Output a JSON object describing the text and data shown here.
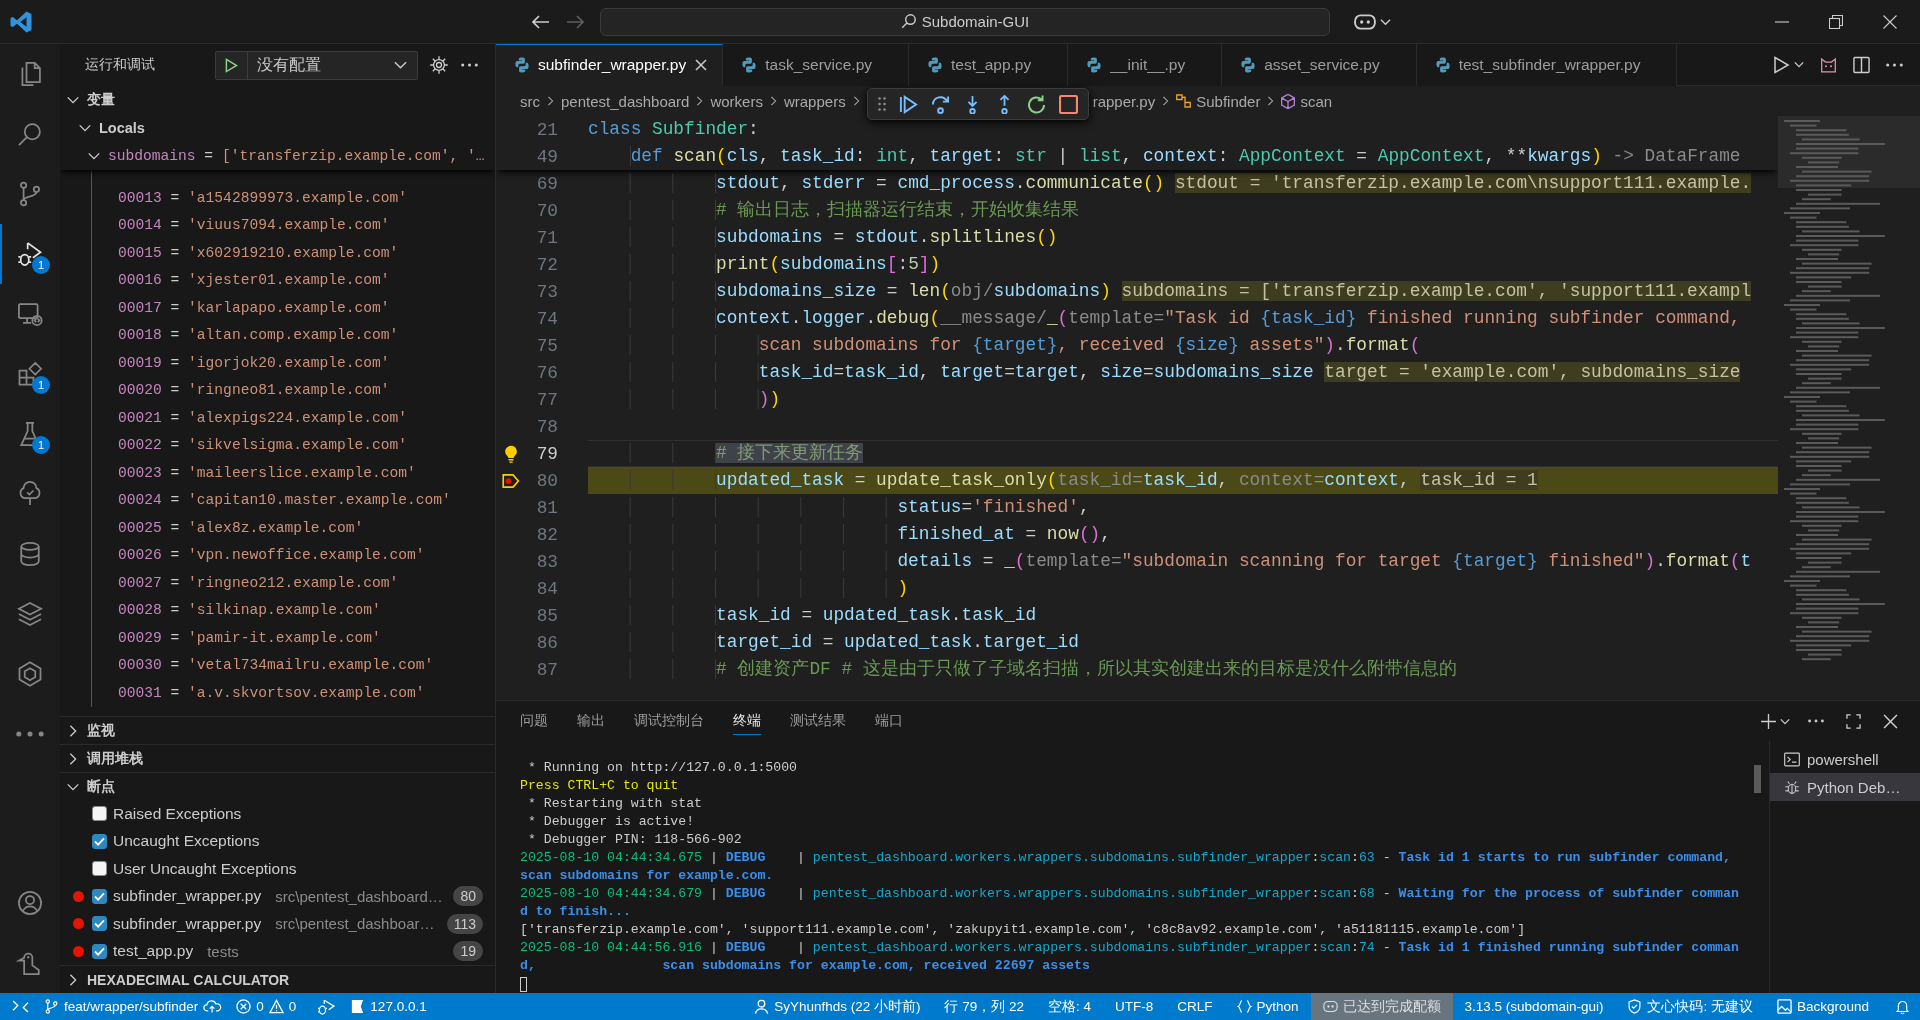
{
  "title_bar": {
    "nav": [
      {
        "disabled": false
      },
      {
        "disabled": true
      }
    ],
    "search": "Subdomain-GUI"
  },
  "activity_bar": {
    "items": [
      {
        "selected": false
      },
      {
        "selected": false
      },
      {
        "selected": false
      },
      {
        "selected": true,
        "badge": "1"
      },
      {
        "selected": false
      },
      {
        "selected": false,
        "badge": "1"
      },
      {
        "selected": false,
        "badge": "1"
      },
      {
        "selected": false
      },
      {
        "selected": false
      },
      {
        "selected": false
      },
      {
        "selected": false
      },
      {
        "selected": false
      }
    ],
    "bottom": [
      {
        "selected": false
      },
      {
        "selected": false
      }
    ]
  },
  "sidebar": {
    "title": "运行和调试",
    "configuration": "没有配置",
    "sections": [
      {
        "kind": "variables",
        "title": "变量",
        "expanded": true,
        "scopes": [
          {
            "name": "Locals",
            "expanded": true,
            "variables": [
              {
                "name": "subdomains",
                "sign": "=",
                "value": "['transferzip.example.com', '…",
                "expanded": true,
                "children": [
                  {
                    "name": "00013",
                    "sign": "=",
                    "value": "'a1542899973.example.com'"
                  },
                  {
                    "name": "00014",
                    "sign": "=",
                    "value": "'viuus7094.example.com'"
                  },
                  {
                    "name": "00015",
                    "sign": "=",
                    "value": "'x602919210.example.com'"
                  },
                  {
                    "name": "00016",
                    "sign": "=",
                    "value": "'xjester01.example.com'"
                  },
                  {
                    "name": "00017",
                    "sign": "=",
                    "value": "'karlapapo.example.com'"
                  },
                  {
                    "name": "00018",
                    "sign": "=",
                    "value": "'altan.comp.example.com'"
                  },
                  {
                    "name": "00019",
                    "sign": "=",
                    "value": "'igorjok20.example.com'"
                  },
                  {
                    "name": "00020",
                    "sign": "=",
                    "value": "'ringneo81.example.com'"
                  },
                  {
                    "name": "00021",
                    "sign": "=",
                    "value": "'alexpigs224.example.com'"
                  },
                  {
                    "name": "00022",
                    "sign": "=",
                    "value": "'sikvelsigma.example.com'"
                  },
                  {
                    "name": "00023",
                    "sign": "=",
                    "value": "'maileerslice.example.com'"
                  },
                  {
                    "name": "00024",
                    "sign": "=",
                    "value": "'capitan10.master.example.com'"
                  },
                  {
                    "name": "00025",
                    "sign": "=",
                    "value": "'alex8z.example.com'"
                  },
                  {
                    "name": "00026",
                    "sign": "=",
                    "value": "'vpn.newoffice.example.com'"
                  },
                  {
                    "name": "00027",
                    "sign": "=",
                    "value": "'ringneo212.example.com'"
                  },
                  {
                    "name": "00028",
                    "sign": "=",
                    "value": "'silkinap.example.com'"
                  },
                  {
                    "name": "00029",
                    "sign": "=",
                    "value": "'pamir-it.example.com'"
                  },
                  {
                    "name": "00030",
                    "sign": "=",
                    "value": "'vetal734mailru.example.com'"
                  },
                  {
                    "name": "00031",
                    "sign": "=",
                    "value": "'a.v.skvortsov.example.com'"
                  }
                ]
              }
            ]
          }
        ]
      },
      {
        "kind": "plain",
        "title": "监视",
        "expanded": false
      },
      {
        "kind": "plain",
        "title": "调用堆栈",
        "expanded": false
      },
      {
        "kind": "breakpoints",
        "title": "断点",
        "expanded": true,
        "items": [
          {
            "kind": "exception",
            "label": "Raised Exceptions",
            "checked": false
          },
          {
            "kind": "exception",
            "label": "Uncaught Exceptions",
            "checked": true
          },
          {
            "kind": "exception",
            "label": "User Uncaught Exceptions",
            "checked": false
          },
          {
            "kind": "file",
            "label": "subfinder_wrapper.py",
            "path": "src\\pentest_dashboard…",
            "line": "80",
            "checked": true
          },
          {
            "kind": "file",
            "label": "subfinder_wrapper.py",
            "path": "src\\pentest_dashboar…",
            "line": "113",
            "checked": true
          },
          {
            "kind": "file",
            "label": "test_app.py",
            "path": "tests",
            "line": "19",
            "checked": true
          }
        ]
      },
      {
        "kind": "plain",
        "title": "HEXADECIMAL CALCULATOR",
        "expanded": false
      }
    ]
  },
  "editor": {
    "tabs": [
      {
        "label": "subfinder_wrapper.py",
        "selected": true
      },
      {
        "label": "task_service.py",
        "selected": false
      },
      {
        "label": "test_app.py",
        "selected": false
      },
      {
        "label": "__init__.py",
        "selected": false
      },
      {
        "label": "asset_service.py",
        "selected": false
      },
      {
        "label": "test_subfinder_wrapper.py",
        "selected": false
      }
    ],
    "breadcrumbs": {
      "before_toolbar": [
        {
          "kind": "path",
          "label": "src"
        },
        {
          "kind": "path",
          "label": "pentest_dashboard"
        },
        {
          "kind": "path",
          "label": "workers"
        },
        {
          "kind": "path",
          "label": "wrappers"
        }
      ],
      "after_toolbar": [
        {
          "kind": "path",
          "label": "rapper.py"
        },
        {
          "kind": "class",
          "label": "Subfinder"
        },
        {
          "kind": "method",
          "label": "scan"
        }
      ]
    },
    "sticky": [
      {
        "number": "21",
        "tokens": [
          {
            "kind": "kw",
            "text": "class "
          },
          {
            "kind": "cls",
            "text": "Subfinder"
          },
          {
            "kind": "op",
            "text": ":"
          }
        ]
      },
      {
        "number": "49",
        "tokens": [
          {
            "kind": "kw",
            "text": "    def "
          },
          {
            "kind": "fn",
            "text": "scan"
          },
          {
            "kind": "br1",
            "text": "("
          },
          {
            "kind": "var",
            "text": "cls"
          },
          {
            "kind": "op",
            "text": ", "
          },
          {
            "kind": "var",
            "text": "task_id"
          },
          {
            "kind": "op",
            "text": ": "
          },
          {
            "kind": "cls",
            "text": "int"
          },
          {
            "kind": "op",
            "text": ", "
          },
          {
            "kind": "var",
            "text": "target"
          },
          {
            "kind": "op",
            "text": ": "
          },
          {
            "kind": "cls",
            "text": "str"
          },
          {
            "kind": "op",
            "text": " | "
          },
          {
            "kind": "cls",
            "text": "list"
          },
          {
            "kind": "op",
            "text": ", "
          },
          {
            "kind": "var",
            "text": "context"
          },
          {
            "kind": "op",
            "text": ": "
          },
          {
            "kind": "cls",
            "text": "AppContext"
          },
          {
            "kind": "op",
            "text": " = "
          },
          {
            "kind": "cls",
            "text": "AppContext"
          },
          {
            "kind": "op",
            "text": ", **"
          },
          {
            "kind": "var",
            "text": "kwargs"
          },
          {
            "kind": "br1",
            "text": ")"
          },
          {
            "kind": "hint",
            "text": " -> DataFrame"
          }
        ]
      }
    ],
    "lines": [
      {
        "number": "69",
        "active": false,
        "paused": false,
        "code_action": false,
        "tokens": [
          {
            "kind": "var",
            "text": "            stdout"
          },
          {
            "kind": "op",
            "text": ", "
          },
          {
            "kind": "var",
            "text": "stderr"
          },
          {
            "kind": "op",
            "text": " = "
          },
          {
            "kind": "var",
            "text": "cmd_process"
          },
          {
            "kind": "op",
            "text": "."
          },
          {
            "kind": "fn",
            "text": "communicate"
          },
          {
            "kind": "br1",
            "text": "() "
          },
          {
            "kind": "inline",
            "text": "stdout = 'transferzip.example.com\\nsupport111.example."
          }
        ]
      },
      {
        "number": "70",
        "active": false,
        "paused": false,
        "code_action": false,
        "tokens": [
          {
            "kind": "com",
            "text": "            # 输出日志，扫描器运行结束，开始收集结果"
          }
        ]
      },
      {
        "number": "71",
        "active": false,
        "paused": false,
        "code_action": false,
        "tokens": [
          {
            "kind": "var",
            "text": "            subdomains"
          },
          {
            "kind": "op",
            "text": " = "
          },
          {
            "kind": "var",
            "text": "stdout"
          },
          {
            "kind": "op",
            "text": "."
          },
          {
            "kind": "fn",
            "text": "splitlines"
          },
          {
            "kind": "br1",
            "text": "()"
          }
        ]
      },
      {
        "number": "72",
        "active": false,
        "paused": false,
        "code_action": false,
        "tokens": [
          {
            "kind": "fn",
            "text": "            print"
          },
          {
            "kind": "br1",
            "text": "("
          },
          {
            "kind": "var",
            "text": "subdomains"
          },
          {
            "kind": "br2",
            "text": "["
          },
          {
            "kind": "op",
            "text": ":"
          },
          {
            "kind": "num",
            "text": "5"
          },
          {
            "kind": "br2",
            "text": "]"
          },
          {
            "kind": "br1",
            "text": ")"
          }
        ]
      },
      {
        "number": "73",
        "active": false,
        "paused": false,
        "code_action": false,
        "tokens": [
          {
            "kind": "var",
            "text": "            subdomains_size"
          },
          {
            "kind": "op",
            "text": " = "
          },
          {
            "kind": "fn",
            "text": "len"
          },
          {
            "kind": "br1",
            "text": "("
          },
          {
            "kind": "hint",
            "text": "obj/"
          },
          {
            "kind": "var",
            "text": "subdomains"
          },
          {
            "kind": "br1",
            "text": ") "
          },
          {
            "kind": "inline",
            "text": "subdomains = ['transferzip.example.com', 'support111.exampl"
          }
        ]
      },
      {
        "number": "74",
        "active": false,
        "paused": false,
        "code_action": false,
        "tokens": [
          {
            "kind": "var",
            "text": "            context"
          },
          {
            "kind": "op",
            "text": "."
          },
          {
            "kind": "var",
            "text": "logger"
          },
          {
            "kind": "op",
            "text": "."
          },
          {
            "kind": "fn",
            "text": "debug"
          },
          {
            "kind": "br1",
            "text": "("
          },
          {
            "kind": "hint",
            "text": "__message/"
          },
          {
            "kind": "fn",
            "text": "_"
          },
          {
            "kind": "br2",
            "text": "("
          },
          {
            "kind": "hint",
            "text": "template="
          },
          {
            "kind": "str",
            "text": "\"Task id "
          },
          {
            "kind": "fmt",
            "text": "{task_id}"
          },
          {
            "kind": "str",
            "text": " finished running subfinder command,"
          }
        ]
      },
      {
        "number": "75",
        "active": false,
        "paused": false,
        "code_action": false,
        "tokens": [
          {
            "kind": "str",
            "text": "                scan subdomains for "
          },
          {
            "kind": "fmt",
            "text": "{target}"
          },
          {
            "kind": "str",
            "text": ", received "
          },
          {
            "kind": "fmt",
            "text": "{size}"
          },
          {
            "kind": "str",
            "text": " assets\""
          },
          {
            "kind": "br2",
            "text": ")"
          },
          {
            "kind": "op",
            "text": "."
          },
          {
            "kind": "fn",
            "text": "format"
          },
          {
            "kind": "br2",
            "text": "("
          }
        ]
      },
      {
        "number": "76",
        "active": false,
        "paused": false,
        "code_action": false,
        "tokens": [
          {
            "kind": "var",
            "text": "                task_id"
          },
          {
            "kind": "op",
            "text": "="
          },
          {
            "kind": "var",
            "text": "task_id"
          },
          {
            "kind": "op",
            "text": ", "
          },
          {
            "kind": "var",
            "text": "target"
          },
          {
            "kind": "op",
            "text": "="
          },
          {
            "kind": "var",
            "text": "target"
          },
          {
            "kind": "op",
            "text": ", "
          },
          {
            "kind": "var",
            "text": "size"
          },
          {
            "kind": "op",
            "text": "="
          },
          {
            "kind": "var",
            "text": "subdomains_size "
          },
          {
            "kind": "inline",
            "text": "target = 'example.com', subdomains_size"
          }
        ]
      },
      {
        "number": "77",
        "active": false,
        "paused": false,
        "code_action": false,
        "tokens": [
          {
            "kind": "br2",
            "text": "                )"
          },
          {
            "kind": "br1",
            "text": ")"
          }
        ]
      },
      {
        "number": "78",
        "active": false,
        "paused": false,
        "code_action": false
      },
      {
        "number": "79",
        "active": true,
        "paused": false,
        "code_action": true,
        "tokens": [
          {
            "kind": "sel",
            "text": "            # 接下来更新任务"
          }
        ]
      },
      {
        "number": "80",
        "active": false,
        "paused": true,
        "code_action": false,
        "tokens": [
          {
            "kind": "var",
            "text": "            updated_task"
          },
          {
            "kind": "op",
            "text": " = "
          },
          {
            "kind": "fn",
            "text": "update_task_only"
          },
          {
            "kind": "br1",
            "text": "("
          },
          {
            "kind": "hint",
            "text": "task_id="
          },
          {
            "kind": "var",
            "text": "task_id"
          },
          {
            "kind": "op",
            "text": ", "
          },
          {
            "kind": "hint",
            "text": "context="
          },
          {
            "kind": "var",
            "text": "context"
          },
          {
            "kind": "op",
            "text": ", "
          },
          {
            "kind": "inline",
            "text": "task_id = 1"
          }
        ]
      },
      {
        "number": "81",
        "active": false,
        "paused": false,
        "code_action": false,
        "tokens": [
          {
            "kind": "var",
            "text": "                             status"
          },
          {
            "kind": "op",
            "text": "="
          },
          {
            "kind": "str",
            "text": "'finished'"
          },
          {
            "kind": "op",
            "text": ","
          }
        ]
      },
      {
        "number": "82",
        "active": false,
        "paused": false,
        "code_action": false,
        "tokens": [
          {
            "kind": "var",
            "text": "                             finished_at"
          },
          {
            "kind": "op",
            "text": " = "
          },
          {
            "kind": "fn",
            "text": "now"
          },
          {
            "kind": "br2",
            "text": "()"
          },
          {
            "kind": "op",
            "text": ","
          }
        ]
      },
      {
        "number": "83",
        "active": false,
        "paused": false,
        "code_action": false,
        "tokens": [
          {
            "kind": "var",
            "text": "                             details"
          },
          {
            "kind": "op",
            "text": " = "
          },
          {
            "kind": "fn",
            "text": "_"
          },
          {
            "kind": "br2",
            "text": "("
          },
          {
            "kind": "hint",
            "text": "template="
          },
          {
            "kind": "str",
            "text": "\"subdomain scanning for target "
          },
          {
            "kind": "fmt",
            "text": "{target}"
          },
          {
            "kind": "str",
            "text": " finished\""
          },
          {
            "kind": "br2",
            "text": ")"
          },
          {
            "kind": "op",
            "text": "."
          },
          {
            "kind": "fn",
            "text": "format"
          },
          {
            "kind": "br2",
            "text": "("
          },
          {
            "kind": "var",
            "text": "t"
          }
        ]
      },
      {
        "number": "84",
        "active": false,
        "paused": false,
        "code_action": false,
        "tokens": [
          {
            "kind": "br1",
            "text": "                             )"
          }
        ]
      },
      {
        "number": "85",
        "active": false,
        "paused": false,
        "code_action": false,
        "tokens": [
          {
            "kind": "var",
            "text": "            task_id"
          },
          {
            "kind": "op",
            "text": " = "
          },
          {
            "kind": "var",
            "text": "updated_task"
          },
          {
            "kind": "op",
            "text": "."
          },
          {
            "kind": "var",
            "text": "task_id"
          }
        ]
      },
      {
        "number": "86",
        "active": false,
        "paused": false,
        "code_action": false,
        "tokens": [
          {
            "kind": "var",
            "text": "            target_id"
          },
          {
            "kind": "op",
            "text": " = "
          },
          {
            "kind": "var",
            "text": "updated_task"
          },
          {
            "kind": "op",
            "text": "."
          },
          {
            "kind": "var",
            "text": "target_id"
          }
        ]
      },
      {
        "number": "87",
        "active": false,
        "paused": false,
        "code_action": false,
        "tokens": [
          {
            "kind": "com",
            "text": "            # 创建资产DF # 这是由于只做了子域名扫描，所以其实创建出来的目标是没什么附带信息的"
          }
        ]
      }
    ]
  },
  "panel": {
    "tabs": [
      {
        "label": "问题",
        "selected": false
      },
      {
        "label": "输出",
        "selected": false
      },
      {
        "label": "调试控制台",
        "selected": false
      },
      {
        "label": "终端",
        "selected": true
      },
      {
        "label": "测试结果",
        "selected": false
      },
      {
        "label": "端口",
        "selected": false
      }
    ],
    "terminal": {
      "cursor": true,
      "lines": [
        {
          "segments": [
            {
              "kind": "plain",
              "text": " * Running on http://127.0.0.1:5000"
            }
          ]
        },
        {
          "segments": [
            {
              "kind": "yellow",
              "text": "Press CTRL+C to quit"
            }
          ]
        },
        {
          "segments": [
            {
              "kind": "plain",
              "text": " * Restarting with stat"
            }
          ]
        },
        {
          "segments": [
            {
              "kind": "plain",
              "text": " * Debugger is active!"
            }
          ]
        },
        {
          "segments": [
            {
              "kind": "plain",
              "text": " * Debugger PIN: 118-566-902"
            }
          ]
        },
        {
          "segments": [
            {
              "kind": "time",
              "text": "2025-08-10 04:44:34.675"
            },
            {
              "kind": "plain",
              "text": " | "
            },
            {
              "kind": "level",
              "text": "DEBUG   "
            },
            {
              "kind": "plain",
              "text": " | "
            },
            {
              "kind": "module",
              "text": "pentest_dashboard.workers.wrappers.subdomains.subfinder_wrapper"
            },
            {
              "kind": "plain",
              "text": ":"
            },
            {
              "kind": "module",
              "text": "scan"
            },
            {
              "kind": "plain",
              "text": ":"
            },
            {
              "kind": "module",
              "text": "63"
            },
            {
              "kind": "plain",
              "text": " - "
            },
            {
              "kind": "msg",
              "text": "Task id 1 starts to run subfinder command,"
            }
          ]
        },
        {
          "segments": [
            {
              "kind": "msg",
              "text": "scan subdomains for example.com."
            }
          ]
        },
        {
          "segments": [
            {
              "kind": "time",
              "text": "2025-08-10 04:44:34.679"
            },
            {
              "kind": "plain",
              "text": " | "
            },
            {
              "kind": "level",
              "text": "DEBUG   "
            },
            {
              "kind": "plain",
              "text": " | "
            },
            {
              "kind": "module",
              "text": "pentest_dashboard.workers.wrappers.subdomains.subfinder_wrapper"
            },
            {
              "kind": "plain",
              "text": ":"
            },
            {
              "kind": "module",
              "text": "scan"
            },
            {
              "kind": "plain",
              "text": ":"
            },
            {
              "kind": "module",
              "text": "68"
            },
            {
              "kind": "plain",
              "text": " - "
            },
            {
              "kind": "msg",
              "text": "Waiting for the process of subfinder comman"
            }
          ]
        },
        {
          "segments": [
            {
              "kind": "msg",
              "text": "d to finish..."
            }
          ]
        },
        {
          "segments": [
            {
              "kind": "plain",
              "text": "['transferzip.example.com', 'support111.example.com', 'zakupyit1.example.com', 'c8c8av92.example.com', 'a51181115.example.com']"
            }
          ]
        },
        {
          "segments": [
            {
              "kind": "time",
              "text": "2025-08-10 04:44:56.916"
            },
            {
              "kind": "plain",
              "text": " | "
            },
            {
              "kind": "level",
              "text": "DEBUG   "
            },
            {
              "kind": "plain",
              "text": " | "
            },
            {
              "kind": "module",
              "text": "pentest_dashboard.workers.wrappers.subdomains.subfinder_wrapper"
            },
            {
              "kind": "plain",
              "text": ":"
            },
            {
              "kind": "module",
              "text": "scan"
            },
            {
              "kind": "plain",
              "text": ":"
            },
            {
              "kind": "module",
              "text": "74"
            },
            {
              "kind": "plain",
              "text": " - "
            },
            {
              "kind": "msg",
              "text": "Task id 1 finished running subfinder comman"
            }
          ]
        },
        {
          "segments": [
            {
              "kind": "msg",
              "text": "d,                scan subdomains for example.com, received 22697 assets"
            }
          ]
        }
      ]
    },
    "sessions": [
      {
        "label": "powershell",
        "selected": false
      },
      {
        "label": "Python Deb…",
        "selected": true
      }
    ]
  },
  "status_bar": {
    "branch": "feat/wrapper/subfinder",
    "errors": "0",
    "warnings": "0",
    "port": "127.0.0.1",
    "items": [
      {
        "text": "SyYhunfhds (22 小时前)",
        "highlighted": false
      },
      {
        "text": "行 79，列 22",
        "highlighted": false
      },
      {
        "text": "空格: 4",
        "highlighted": false
      },
      {
        "text": "UTF-8",
        "highlighted": false
      },
      {
        "text": "CRLF",
        "highlighted": false
      },
      {
        "text": "Python",
        "highlighted": false
      },
      {
        "text": "已达到完成配额",
        "highlighted": true
      },
      {
        "text": "3.13.5 (subdomain-gui)",
        "highlighted": false
      },
      {
        "text": "文心快码: 无建议",
        "highlighted": false
      },
      {
        "text": "Background",
        "highlighted": false
      }
    ]
  }
}
